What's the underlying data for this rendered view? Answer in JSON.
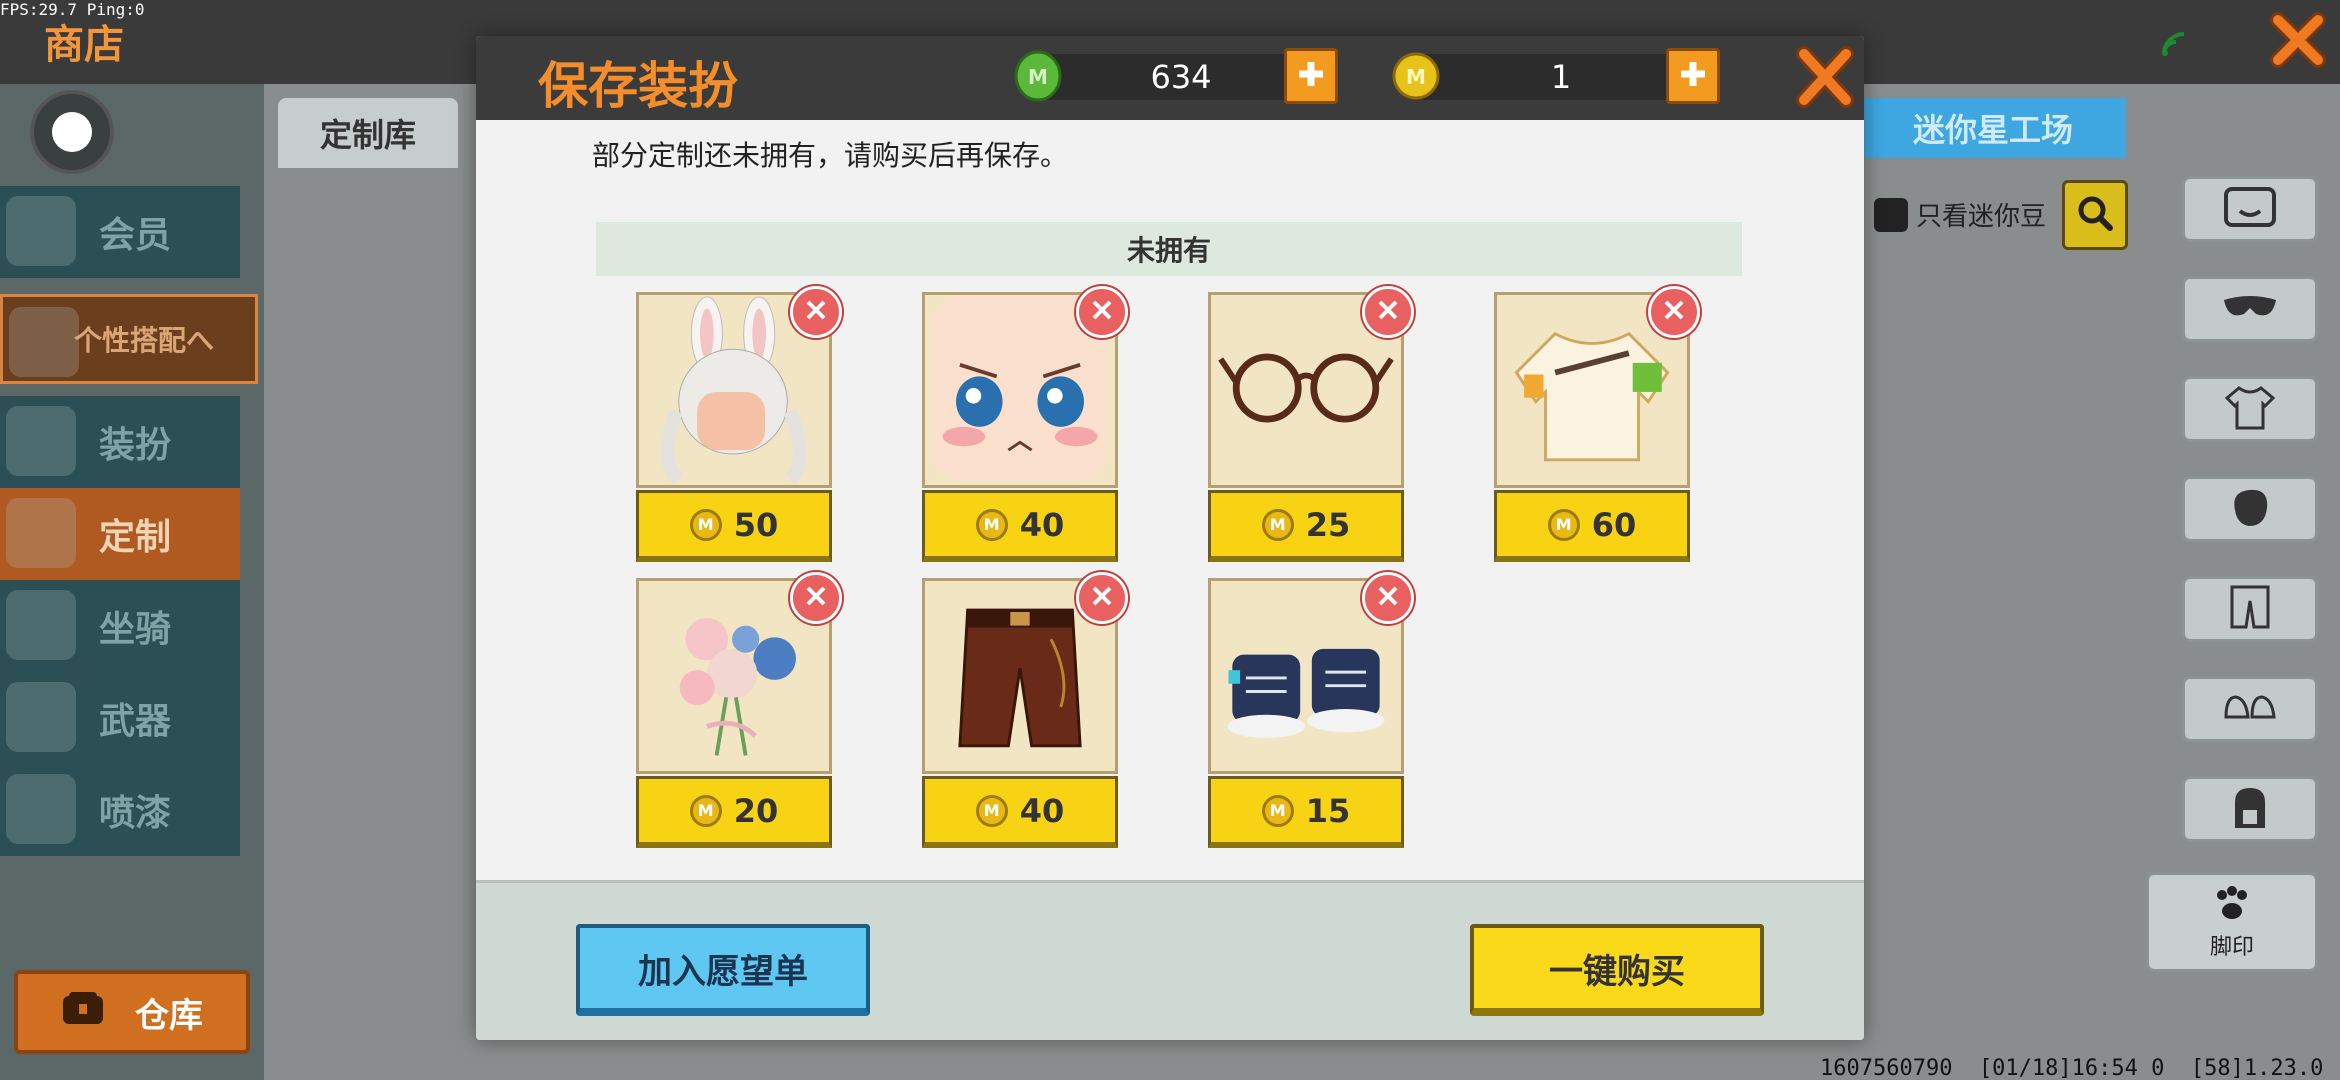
{
  "debug": {
    "fps_ping": "FPS:29.7  Ping:0",
    "footer": "1607560790  [01/18]16:54 0  [58]1.23.0"
  },
  "header": {
    "shop_title": "商店"
  },
  "sidebar": {
    "items": [
      {
        "label": "会员",
        "icon": "vip-icon"
      },
      {
        "label": "个性搭配へ",
        "icon": "trophy-icon"
      },
      {
        "label": "装扮",
        "icon": "shirt-icon"
      },
      {
        "label": "定制",
        "icon": "pencil-icon"
      },
      {
        "label": "坐骑",
        "icon": "mount-icon"
      },
      {
        "label": "武器",
        "icon": "gun-icon"
      },
      {
        "label": "喷漆",
        "icon": "spray-icon"
      }
    ],
    "warehouse_label": "仓库"
  },
  "background": {
    "tab_custom": "定制库",
    "tab_mini": "迷你星工场",
    "only_mini_label": "只看迷你豆",
    "footprint_label": "脚印"
  },
  "modal": {
    "title": "保存装扮",
    "gems": "634",
    "coins": "1",
    "notice": "部分定制还未拥有，请购买后再保存。",
    "section_title": "未拥有",
    "items": [
      {
        "name": "bunny-ear-hair",
        "price": "50"
      },
      {
        "name": "blushing-face",
        "price": "40"
      },
      {
        "name": "round-glasses",
        "price": "25"
      },
      {
        "name": "white-jacket",
        "price": "60"
      },
      {
        "name": "flower-bouquet",
        "price": "20"
      },
      {
        "name": "brown-pants",
        "price": "40"
      },
      {
        "name": "sneakers",
        "price": "15"
      }
    ],
    "wishlist_label": "加入愿望单",
    "buy_all_label": "一键购买"
  },
  "colors": {
    "accent_orange": "#f58e2a",
    "price_yellow": "#f8d313",
    "wishlist_blue": "#5ec8f3",
    "remove_red": "#e8605f"
  }
}
